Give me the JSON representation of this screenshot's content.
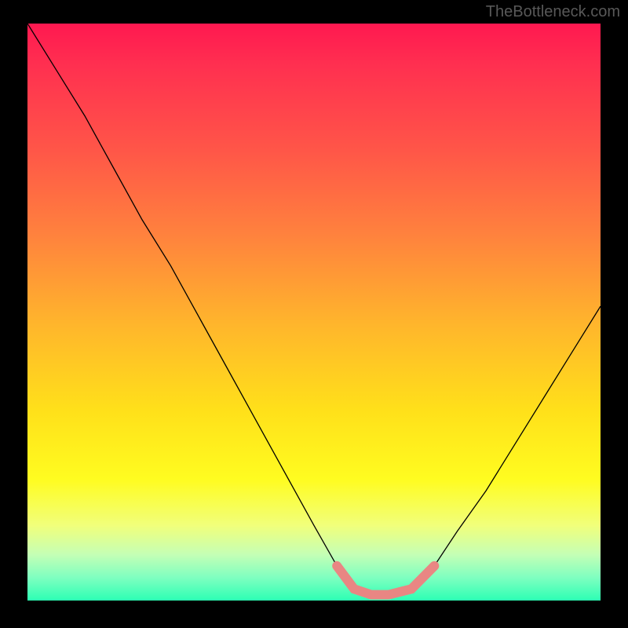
{
  "watermark": "TheBottleneck.com",
  "chart_data": {
    "type": "line",
    "title": "",
    "xlabel": "",
    "ylabel": "",
    "xlim": [
      0,
      100
    ],
    "ylim": [
      0,
      100
    ],
    "series": [
      {
        "name": "bottleneck-curve",
        "x": [
          0,
          5,
          10,
          15,
          20,
          25,
          30,
          35,
          40,
          45,
          50,
          54,
          57,
          60,
          63,
          67,
          71,
          75,
          80,
          85,
          90,
          95,
          100
        ],
        "values": [
          100,
          92,
          84,
          75,
          66,
          58,
          49,
          40,
          31,
          22,
          13,
          6,
          2,
          1,
          1,
          2,
          6,
          12,
          19,
          27,
          35,
          43,
          51
        ]
      }
    ],
    "highlight_band": {
      "x_start": 54,
      "x_end": 71,
      "color": "#e98683"
    },
    "gradient_stops": [
      {
        "pos": 0.0,
        "color": "#ff1850"
      },
      {
        "pos": 0.22,
        "color": "#ff5648"
      },
      {
        "pos": 0.52,
        "color": "#ffb52c"
      },
      {
        "pos": 0.79,
        "color": "#fffc20"
      },
      {
        "pos": 1.0,
        "color": "#2cffb4"
      }
    ]
  }
}
